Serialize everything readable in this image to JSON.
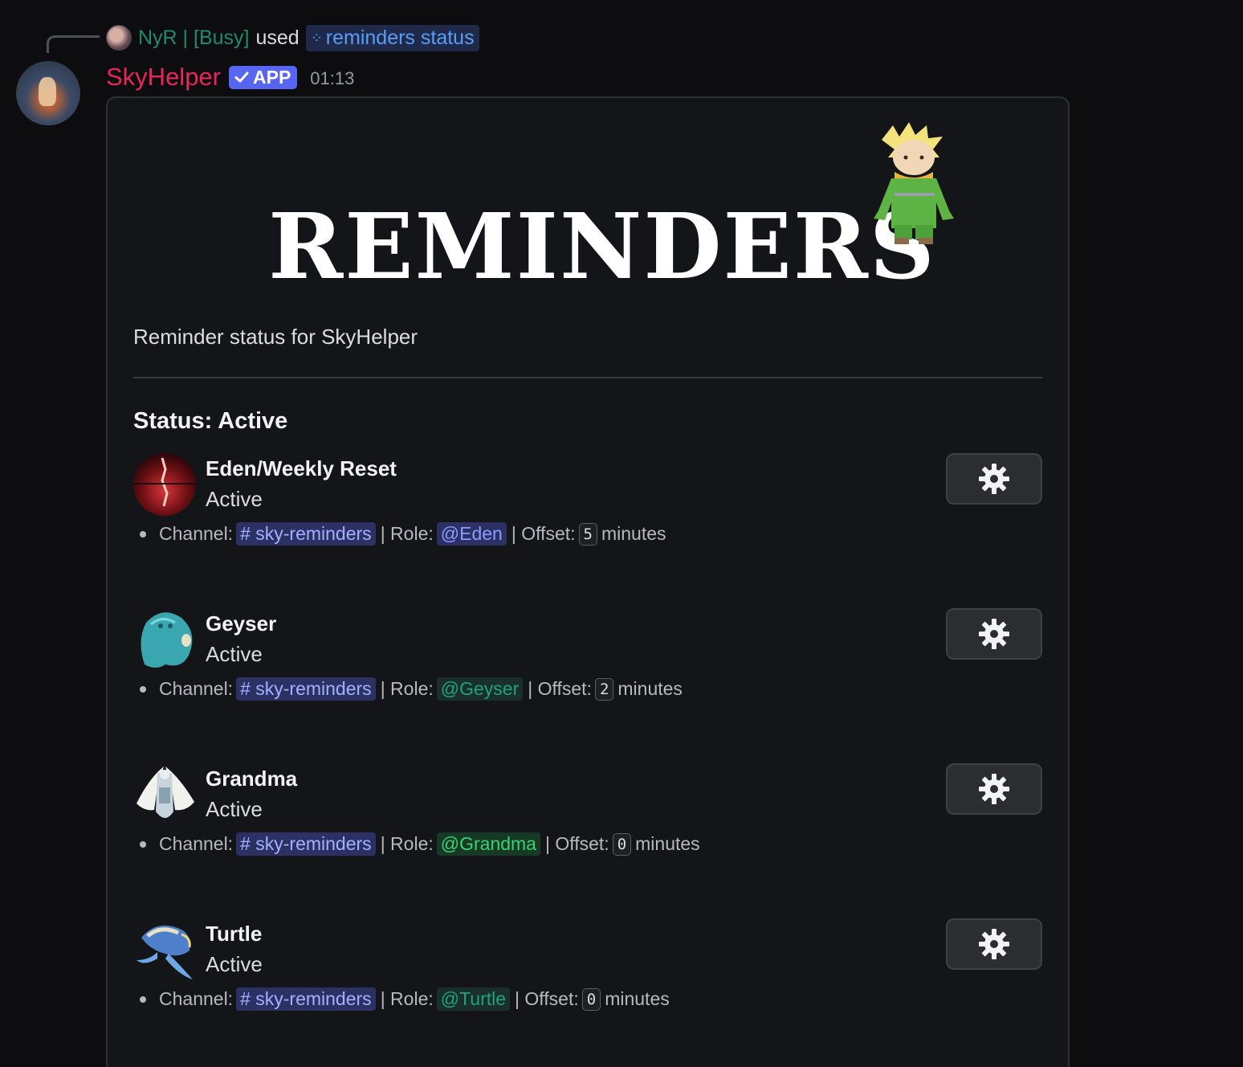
{
  "reply": {
    "user": "NyR | [Busy]",
    "verb": "used",
    "command": "reminders status"
  },
  "message": {
    "author": "SkyHelper",
    "badge": "APP",
    "time": "01:13"
  },
  "embed": {
    "banner_text": "REMINDERS",
    "description": "Reminder status for SkyHelper",
    "status_heading": "Status: Active",
    "reminders": [
      {
        "title": "Eden/Weekly Reset",
        "state": "Active",
        "channel_label": "Channel:",
        "channel": "sky-reminders",
        "role_label": "| Role:",
        "role": "@Eden",
        "offset_label": "| Offset:",
        "offset": "5",
        "unit": "minutes",
        "icon": "eden-icon"
      },
      {
        "title": "Geyser",
        "state": "Active",
        "channel_label": "Channel:",
        "channel": "sky-reminders",
        "role_label": "| Role:",
        "role": "@Geyser",
        "offset_label": "| Offset:",
        "offset": "2",
        "unit": "minutes",
        "icon": "geyser-icon"
      },
      {
        "title": "Grandma",
        "state": "Active",
        "channel_label": "Channel:",
        "channel": "sky-reminders",
        "role_label": "| Role:",
        "role": "@Grandma",
        "offset_label": "| Offset:",
        "offset": "0",
        "unit": "minutes",
        "icon": "grandma-icon"
      },
      {
        "title": "Turtle",
        "state": "Active",
        "channel_label": "Channel:",
        "channel": "sky-reminders",
        "role_label": "| Role:",
        "role": "@Turtle",
        "offset_label": "| Offset:",
        "offset": "0",
        "unit": "minutes",
        "icon": "turtle-icon"
      }
    ]
  },
  "colors": {
    "author": "#e8265e",
    "app_badge": "#5865f2",
    "reply_name": "#1f8b6a",
    "command": "#5b9df5",
    "role_eden": "#8d99ff",
    "role_geyser": "#1fa37a",
    "role_grandma": "#3bd16f",
    "role_turtle": "#1fa37a"
  }
}
